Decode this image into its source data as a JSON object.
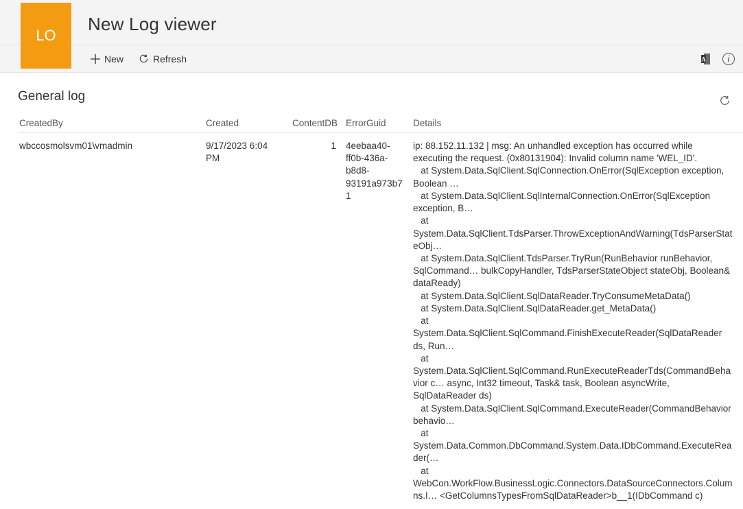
{
  "header": {
    "tile_initials": "LO",
    "title": "New Log viewer",
    "tile_color": "#f39c12"
  },
  "commandbar": {
    "new_label": "New",
    "refresh_label": "Refresh"
  },
  "section": {
    "title": "General log"
  },
  "columns": {
    "createdBy": "CreatedBy",
    "created": "Created",
    "contentDb": "ContentDB",
    "errorGuid": "ErrorGuid",
    "details": "Details"
  },
  "rows": [
    {
      "createdBy": "wbccosmolsvm01\\vmadmin",
      "created": "9/17/2023 6:04 PM",
      "contentDb": "1",
      "errorGuid": "4eebaa40-ff0b-436a-b8d8-93191a973b71",
      "details": "ip: 88.152.11.132 | msg: An unhandled exception has occurred while executing the request. (0x80131904): Invalid column name 'WEL_ID'.\n   at System.Data.SqlClient.SqlConnection.OnError(SqlException exception, Boolean …\n   at System.Data.SqlClient.SqlInternalConnection.OnError(SqlException exception, B…\n   at System.Data.SqlClient.TdsParser.ThrowExceptionAndWarning(TdsParserStateObj…\n   at System.Data.SqlClient.TdsParser.TryRun(RunBehavior runBehavior, SqlCommand… bulkCopyHandler, TdsParserStateObject stateObj, Boolean& dataReady)\n   at System.Data.SqlClient.SqlDataReader.TryConsumeMetaData()\n   at System.Data.SqlClient.SqlDataReader.get_MetaData()\n   at System.Data.SqlClient.SqlCommand.FinishExecuteReader(SqlDataReader ds, Run…\n   at System.Data.SqlClient.SqlCommand.RunExecuteReaderTds(CommandBehavior c… async, Int32 timeout, Task& task, Boolean asyncWrite, SqlDataReader ds)\n   at System.Data.SqlClient.SqlCommand.ExecuteReader(CommandBehavior behavio…\n   at System.Data.Common.DbCommand.System.Data.IDbCommand.ExecuteReader(…\n   at WebCon.WorkFlow.BusinessLogic.Connectors.DataSourceConnectors.Columns.I… <GetColumnsTypesFromSqlDataReader>b__1(IDbCommand c)"
    }
  ]
}
